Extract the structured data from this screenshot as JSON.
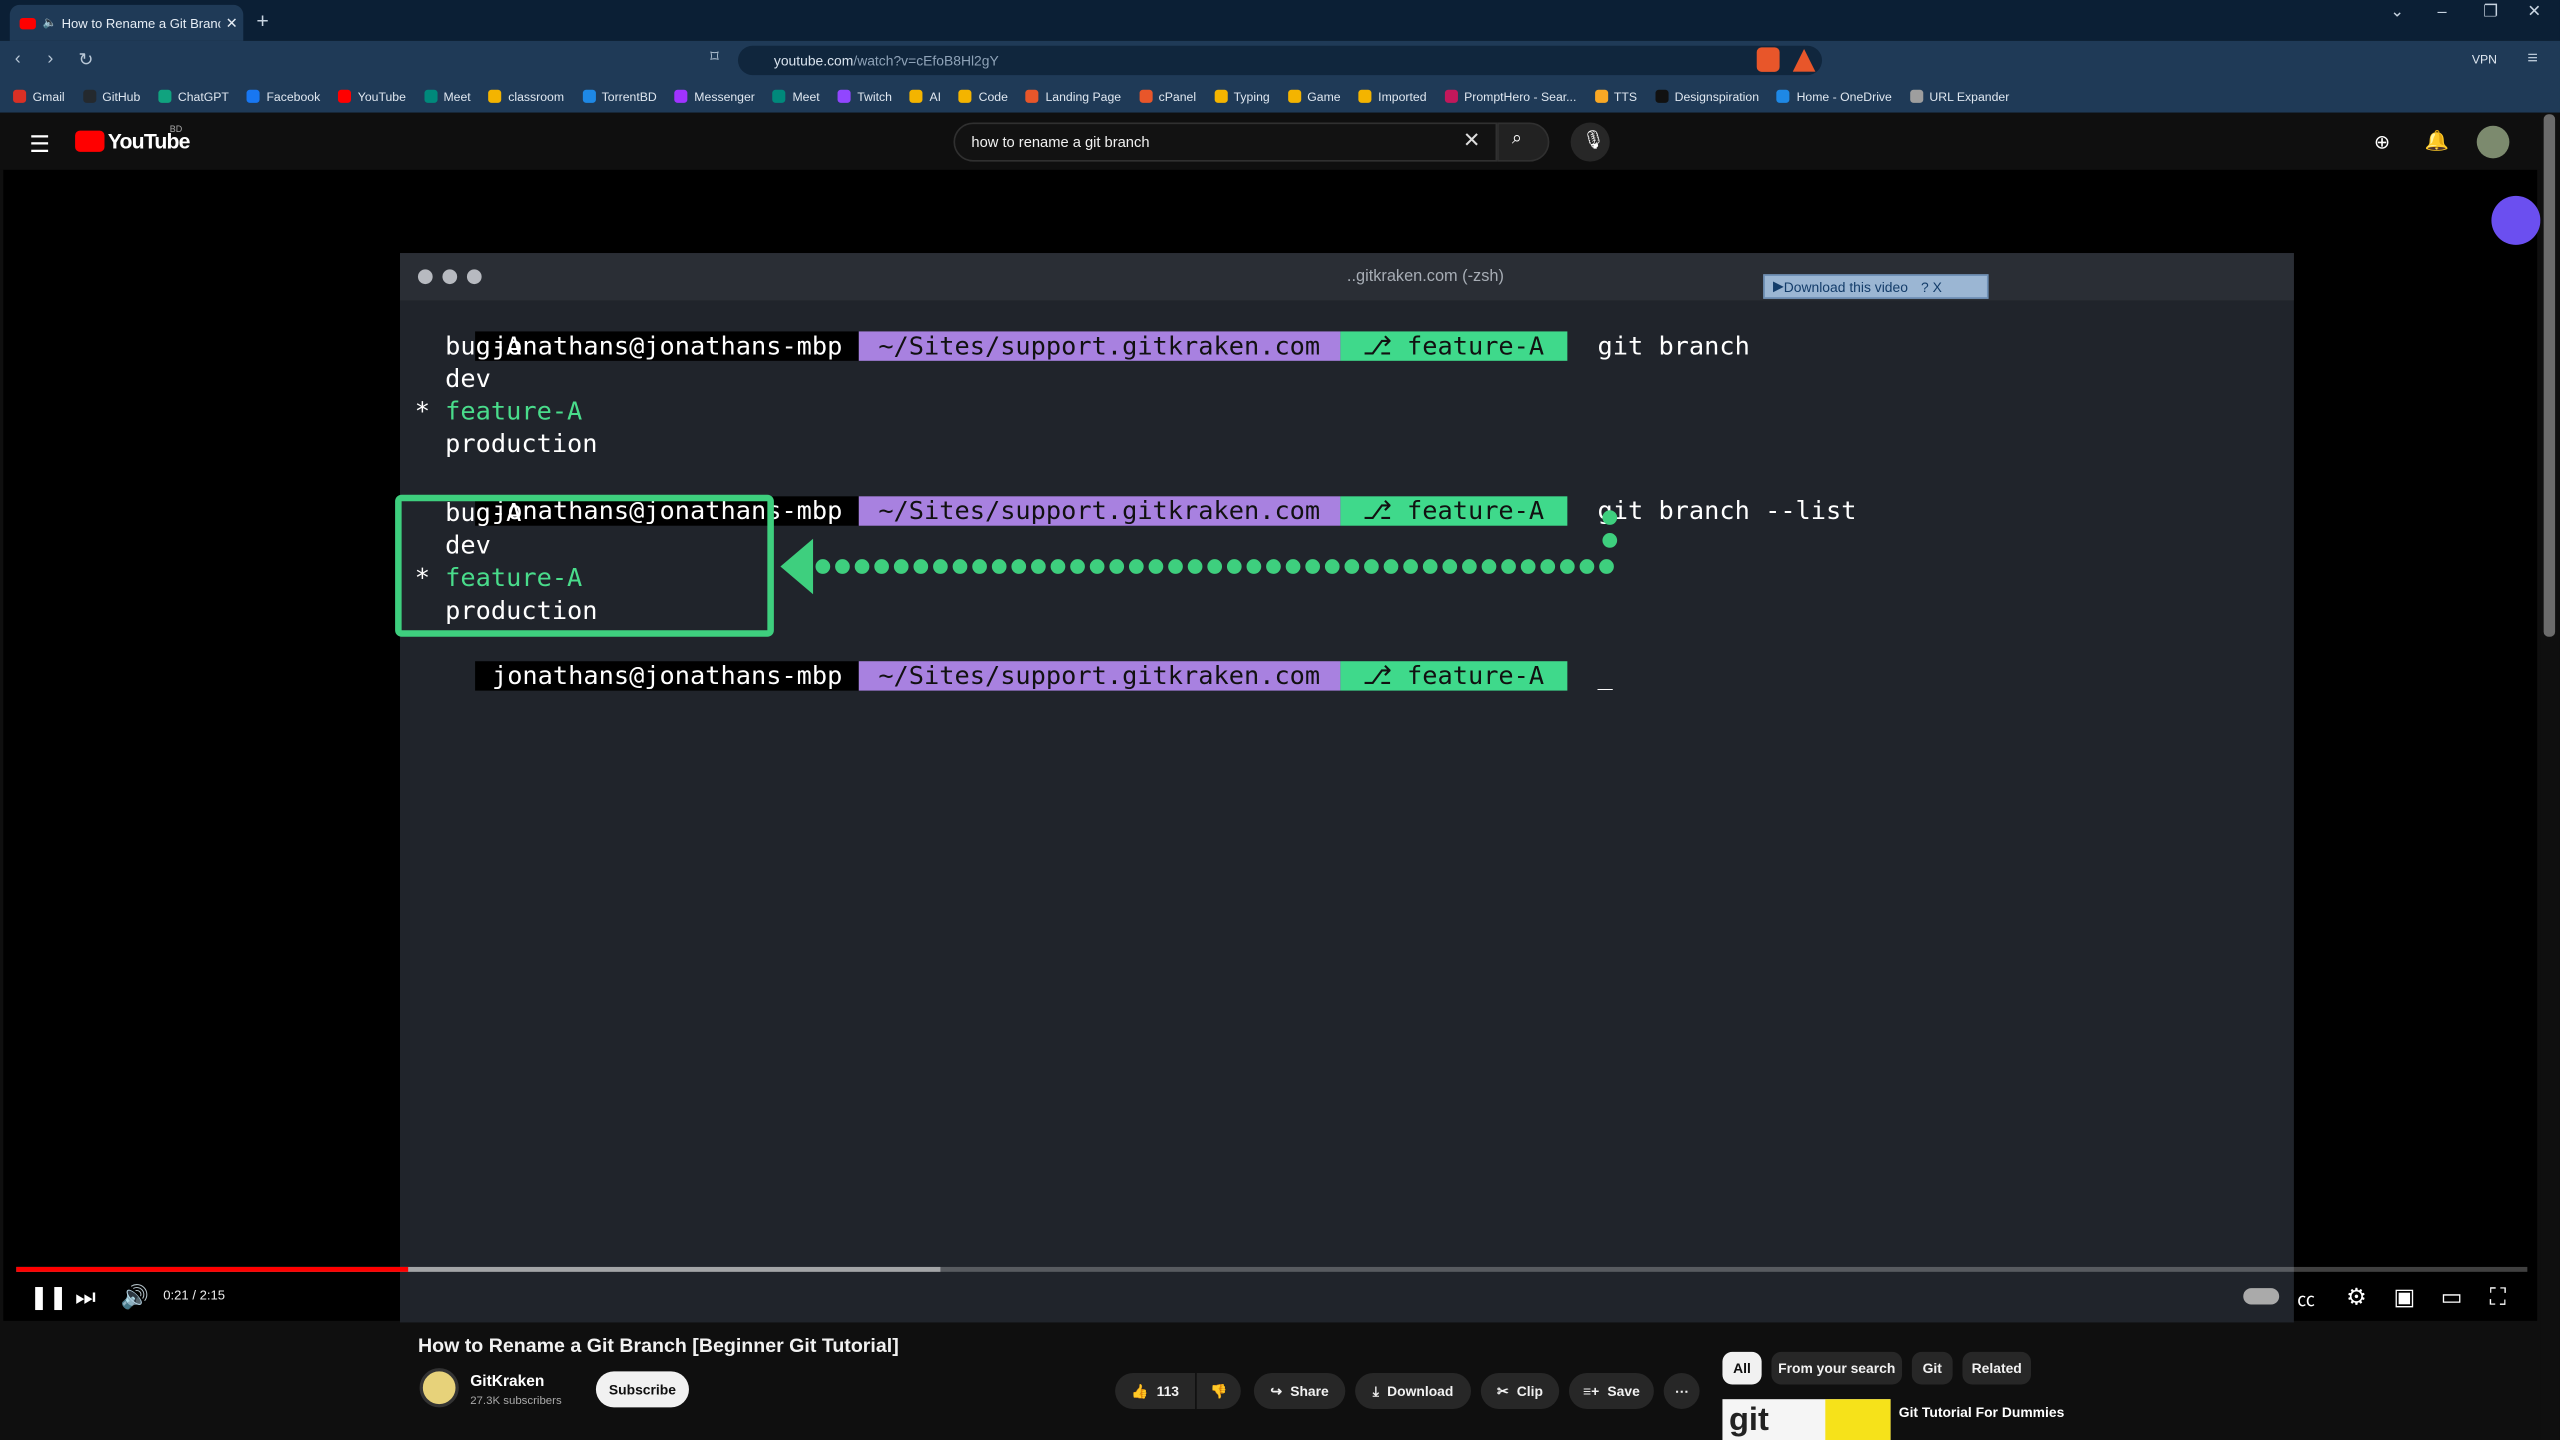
{
  "browser": {
    "tab_title": "How to Rename a Git Branch",
    "url_host": "youtube.com",
    "url_path": "/watch?v=cEfoB8Hl2gY",
    "bookmarks": [
      "Gmail",
      "GitHub",
      "ChatGPT",
      "Facebook",
      "YouTube",
      "Meet",
      "classroom",
      "TorrentBD",
      "Messenger",
      "Meet",
      "Twitch",
      "AI",
      "Code",
      "Landing Page",
      "cPanel",
      "Typing",
      "Game",
      "Imported",
      "PromptHero - Sear...",
      "TTS",
      "Designspiration",
      "Home - OneDrive",
      "URL Expander"
    ],
    "vpn_label": "VPN"
  },
  "youtube": {
    "logo_text": "YouTube",
    "country_code": "BD",
    "search_query": "how to rename a git branch"
  },
  "terminal": {
    "title": "..gitkraken.com (-zsh)",
    "user": "jonathans@jonathans-mbp",
    "path": "~/Sites/support.gitkraken.com",
    "branch": "feature-A",
    "cmd1": "git branch",
    "cmd2": "git branch --list",
    "cursor": "_",
    "branches": [
      "bug-A",
      "dev",
      "feature-A",
      "production"
    ],
    "current_marker": "*",
    "download_label": "Download this video"
  },
  "player": {
    "time": "0:21 / 2:15",
    "progress_pct": 15.6,
    "buffered_pct": 36.8
  },
  "video": {
    "title": "How to Rename a Git Branch [Beginner Git Tutorial]",
    "channel": "GitKraken",
    "subscribers": "27.3K subscribers",
    "subscribe": "Subscribe",
    "likes": "113",
    "share": "Share",
    "download": "Download",
    "clip": "Clip",
    "save": "Save"
  },
  "chips": [
    "All",
    "From your search",
    "Git",
    "Related"
  ],
  "recommendation": {
    "title": "Git Tutorial For Dummies",
    "thumb_text": "git"
  }
}
